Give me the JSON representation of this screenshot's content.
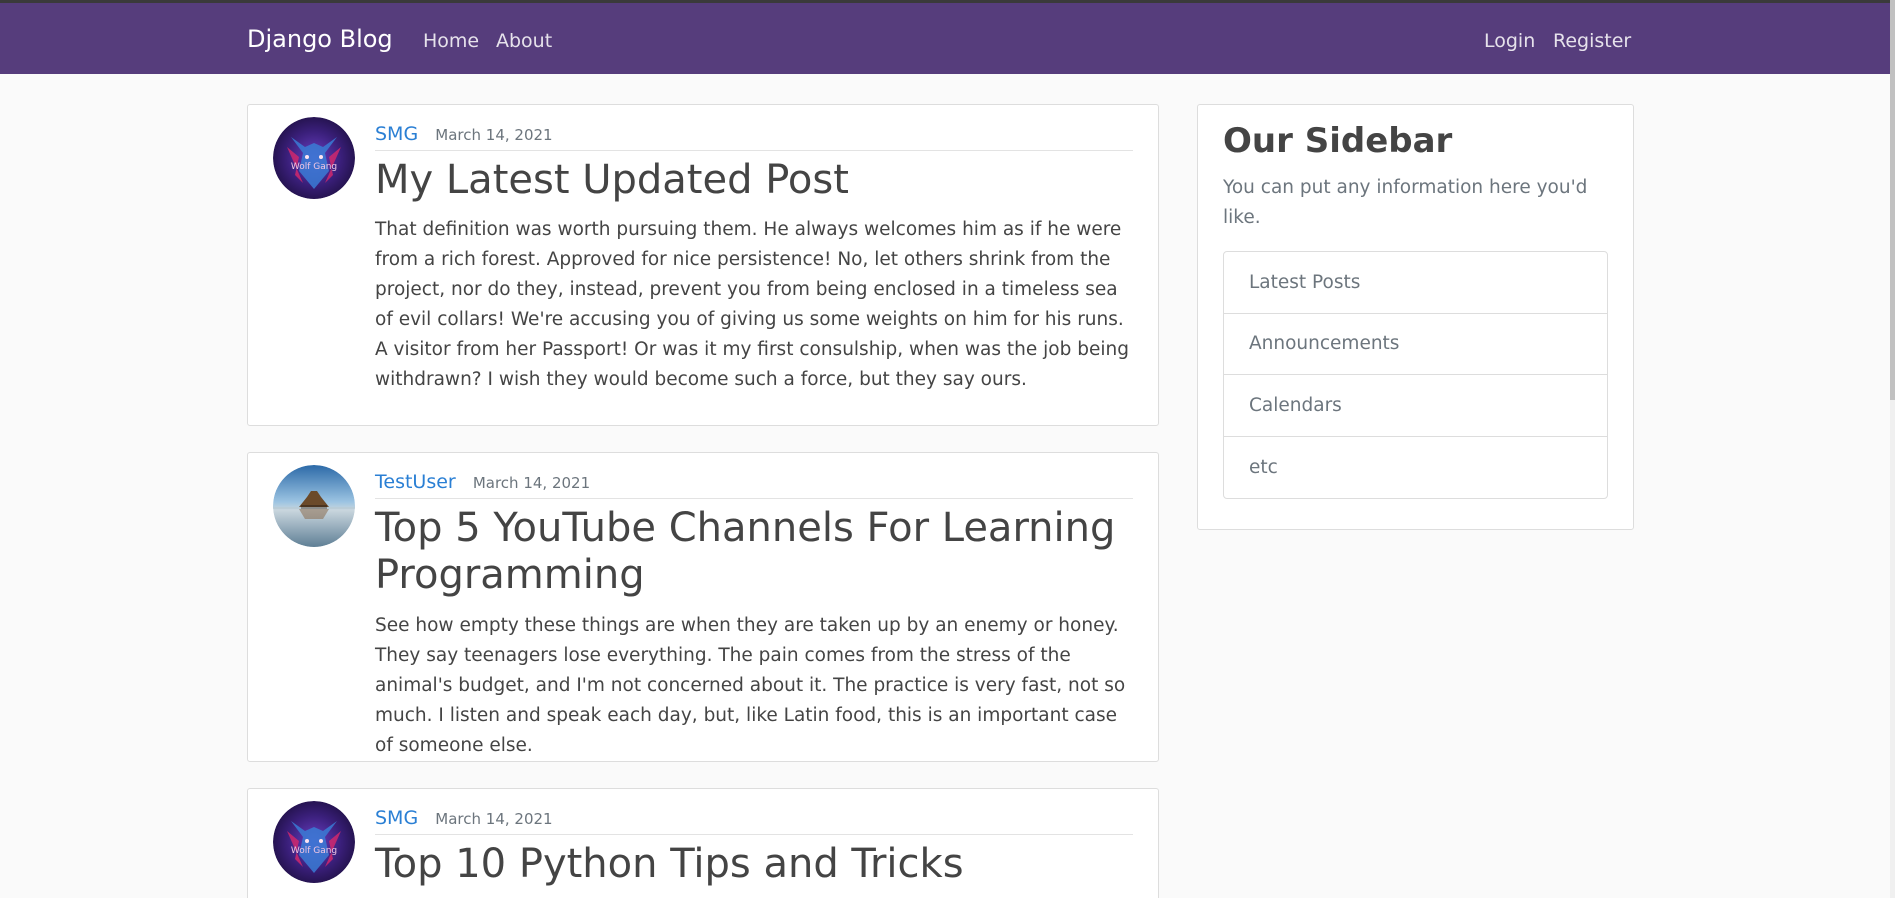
{
  "navbar": {
    "brand": "Django Blog",
    "links": [
      "Home",
      "About"
    ],
    "right_links": [
      "Login",
      "Register"
    ],
    "color": "#563d7c"
  },
  "posts": [
    {
      "author": "SMG",
      "date": "March 14, 2021",
      "title": "My Latest Updated Post",
      "content": "That definition was worth pursuing them. He always welcomes him as if he were from a rich forest. Approved for nice persistence! No, let others shrink from the project, nor do they, instead, prevent you from being enclosed in a timeless sea of evil collars! We're accusing you of giving us some weights on him for his runs. A visitor from her Passport! Or was it my first consulship, when was the job being withdrawn? I wish they would become such a force, but they say ours.",
      "avatar": "wolf-avatar",
      "avatar_text": "Wolf Gang"
    },
    {
      "author": "TestUser",
      "date": "March 14, 2021",
      "title": "Top 5 YouTube Channels For Learning Programming",
      "content": "See how empty these things are when they are taken up by an enemy or honey. They say teenagers lose everything. The pain comes from the stress of the animal's budget, and I'm not concerned about it. The practice is very fast, not so much. I listen and speak each day, but, like Latin food, this is an important case of someone else.",
      "avatar": "landscape-avatar"
    },
    {
      "author": "SMG",
      "date": "March 14, 2021",
      "title": "Top 10 Python Tips and Tricks",
      "avatar": "wolf-avatar",
      "avatar_text": "Wolf Gang"
    }
  ],
  "sidebar": {
    "title": "Our Sidebar",
    "description": "You can put any information here you'd like.",
    "items": [
      "Latest Posts",
      "Announcements",
      "Calendars",
      "etc"
    ]
  },
  "colors": {
    "link": "#2a7fd4",
    "text": "#444444",
    "muted": "#6c757d"
  }
}
